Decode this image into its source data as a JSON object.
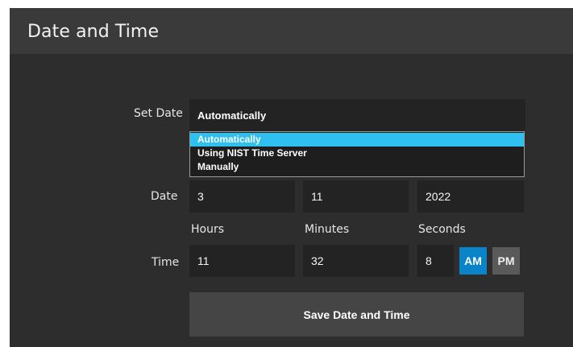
{
  "header": {
    "title": "Date and Time"
  },
  "set_date": {
    "label": "Set Date",
    "selected": "Automatically",
    "options": [
      "Automatically",
      "Using NIST Time Server",
      "Manually"
    ]
  },
  "date": {
    "label": "Date",
    "day": "3",
    "month": "11",
    "year": "2022"
  },
  "time": {
    "label": "Time",
    "hours_label": "Hours",
    "minutes_label": "Minutes",
    "seconds_label": "Seconds",
    "hours": "11",
    "minutes": "32",
    "seconds": "8",
    "am_label": "AM",
    "pm_label": "PM",
    "period_selected": "AM"
  },
  "actions": {
    "save_label": "Save Date and Time"
  },
  "colors": {
    "accent": "#2ec1f0",
    "am_active": "#0a83c9",
    "panel_bg": "#2d2d2d",
    "header_bg": "#3a3a3a",
    "field_bg": "#232323"
  }
}
